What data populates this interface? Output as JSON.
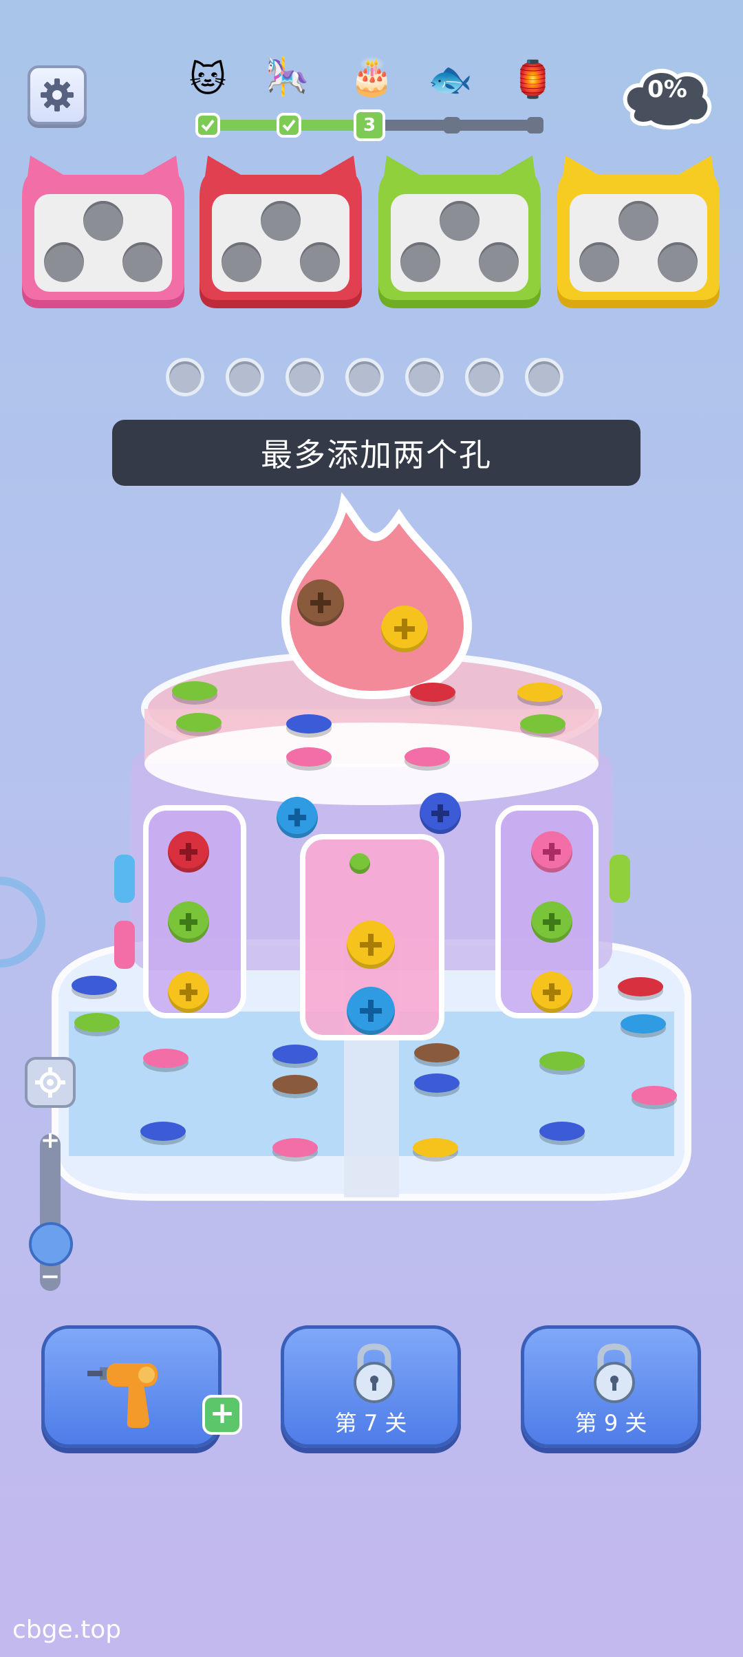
{
  "header": {
    "settings_icon": "gear-icon",
    "level_icons": [
      "cat-icon",
      "rocking-horse-icon",
      "cake-icon",
      "fish-icon",
      "lantern-icon"
    ],
    "current_level_number": "3",
    "completion_percent": "0%"
  },
  "boxes": [
    {
      "color": "#f26ea6",
      "dark": "#d94c8b"
    },
    {
      "color": "#e0404f",
      "dark": "#bd2a39"
    },
    {
      "color": "#90d03c",
      "dark": "#6fae23"
    },
    {
      "color": "#f7cc22",
      "dark": "#dca80f"
    }
  ],
  "slots_count": 7,
  "banner": {
    "text": "最多添加两个孔"
  },
  "tools": [
    {
      "icon": "drill-icon",
      "label": ""
    },
    {
      "icon": "lock-icon",
      "label": "第 7 关"
    },
    {
      "icon": "lock-icon",
      "label": "第 9 关"
    }
  ],
  "watermark": "cbge.top"
}
